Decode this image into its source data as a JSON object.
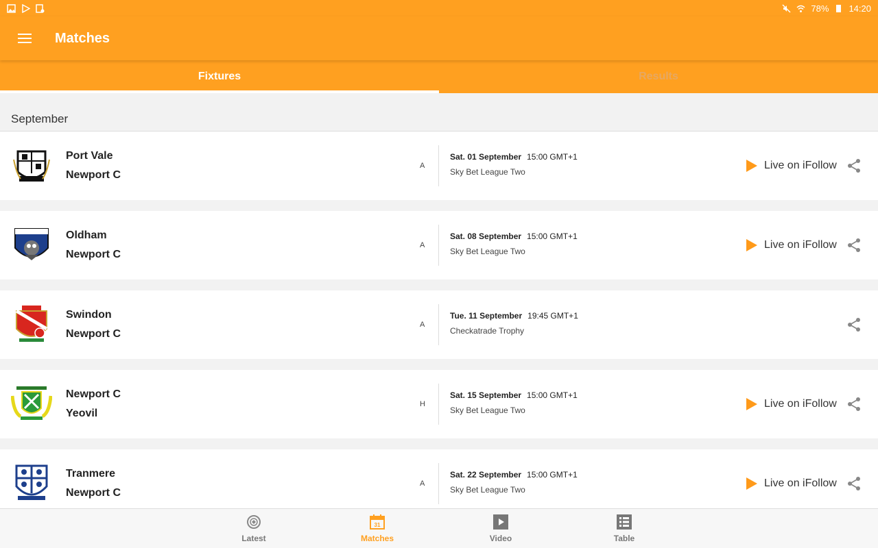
{
  "statusbar": {
    "battery": "78%",
    "time": "14:20"
  },
  "appbar": {
    "title": "Matches"
  },
  "tabs": [
    {
      "label": "Fixtures"
    },
    {
      "label": "Results"
    }
  ],
  "month": "September",
  "fixtures": [
    {
      "home": "Port Vale",
      "away": "Newport C",
      "venue": "A",
      "date": "Sat. 01 September",
      "time": "15:00 GMT+1",
      "competition": "Sky Bet League Two",
      "live": "Live on iFollow"
    },
    {
      "home": "Oldham",
      "away": "Newport C",
      "venue": "A",
      "date": "Sat. 08 September",
      "time": "15:00 GMT+1",
      "competition": "Sky Bet League Two",
      "live": "Live on iFollow"
    },
    {
      "home": "Swindon",
      "away": "Newport C",
      "venue": "A",
      "date": "Tue. 11 September",
      "time": "19:45 GMT+1",
      "competition": "Checkatrade Trophy",
      "live": ""
    },
    {
      "home": "Newport C",
      "away": "Yeovil",
      "venue": "H",
      "date": "Sat. 15 September",
      "time": "15:00 GMT+1",
      "competition": "Sky Bet League Two",
      "live": "Live on iFollow"
    },
    {
      "home": "Tranmere",
      "away": "Newport C",
      "venue": "A",
      "date": "Sat. 22 September",
      "time": "15:00 GMT+1",
      "competition": "Sky Bet League Two",
      "live": "Live on iFollow"
    }
  ],
  "bottomnav": [
    {
      "label": "Latest"
    },
    {
      "label": "Matches",
      "icon_text": "31"
    },
    {
      "label": "Video"
    },
    {
      "label": "Table"
    }
  ],
  "colors": {
    "accent": "#ffa020",
    "play": "#ff9a1a"
  }
}
